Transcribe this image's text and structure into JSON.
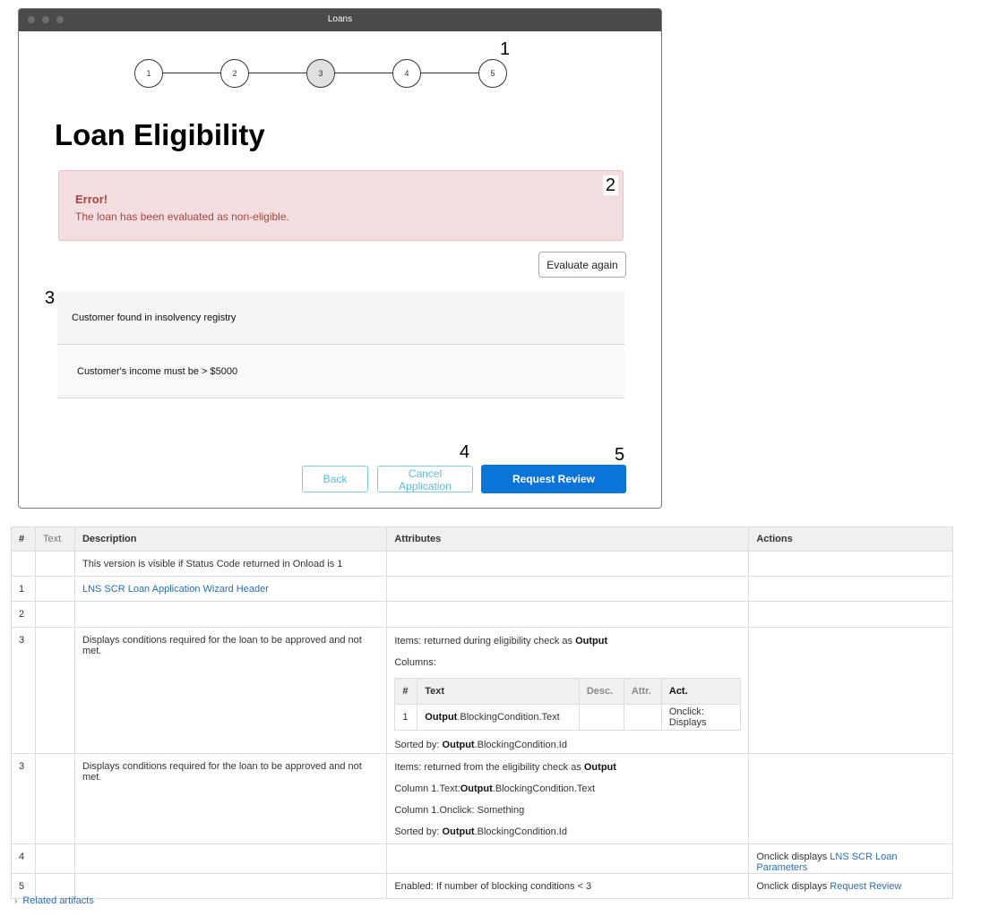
{
  "window": {
    "title": "Loans"
  },
  "stepper": {
    "steps": [
      "1",
      "2",
      "3",
      "4",
      "5"
    ],
    "active_step": "3"
  },
  "callouts": [
    "1",
    "2",
    "3",
    "4",
    "5"
  ],
  "page_title": "Loan Eligibility",
  "alert": {
    "heading": "Error!",
    "message": "The loan has been evaluated as non-eligible."
  },
  "evaluate_label": "Evaluate again",
  "conditions": [
    "Customer  found in insolvency registry",
    "Customer's income must be > $5000"
  ],
  "buttons": {
    "back": "Back",
    "cancel": "Cancel Application",
    "review": "Request Review"
  },
  "spec": {
    "headers": {
      "num": "#",
      "text": "Text",
      "desc": "Description",
      "attr": "Attributes",
      "actions": "Actions"
    },
    "r0": {
      "desc": "This version is visible if  Status Code returned in Onload is 1"
    },
    "r1": {
      "num": "1",
      "desc_link": "LNS SCR Loan Application Wizard Header"
    },
    "r2": {
      "num": "2"
    },
    "r3": {
      "num": "3",
      "desc": "Displays conditions required for the loan to be approved and not met.",
      "items_pre": "Items: returned during eligibility check as ",
      "items_bold": "Output",
      "columns": "Columns:",
      "inner_headers": {
        "num": "#",
        "text": "Text",
        "desc": "Desc.",
        "attr": "Attr.",
        "act": "Act."
      },
      "inner_row": {
        "num": "1",
        "text_bold": "Output",
        "text_rest": ".BlockingCondition.Text",
        "act": "Onclick: Displays"
      },
      "sorted_pre": "Sorted by: ",
      "sorted_bold": "Output",
      "sorted_rest": ".BlockingCondition.Id"
    },
    "r4": {
      "num": "3",
      "desc": "Displays conditions required for the loan to be approved and not met.",
      "items_pre": "Items: returned from the eligibility check as ",
      "items_bold": "Output",
      "col_text_pre": "Column 1.Text:",
      "col_text_bold": "Output",
      "col_text_rest": ".BlockingCondition.Text",
      "col_onclick": "Column 1.Onclick: Something",
      "sorted_pre": "Sorted by: ",
      "sorted_bold": "Output",
      "sorted_rest": ".BlockingCondition.Id"
    },
    "r5": {
      "num": "4",
      "action_pre": "Onclick displays ",
      "action_link": "LNS SCR Loan Parameters"
    },
    "r6": {
      "num": "5",
      "attr": "Enabled: If number of blocking conditions < 3",
      "action_pre": "Onclick displays ",
      "action_link": "Request Review"
    }
  },
  "related_artifacts": "Related artifacts"
}
